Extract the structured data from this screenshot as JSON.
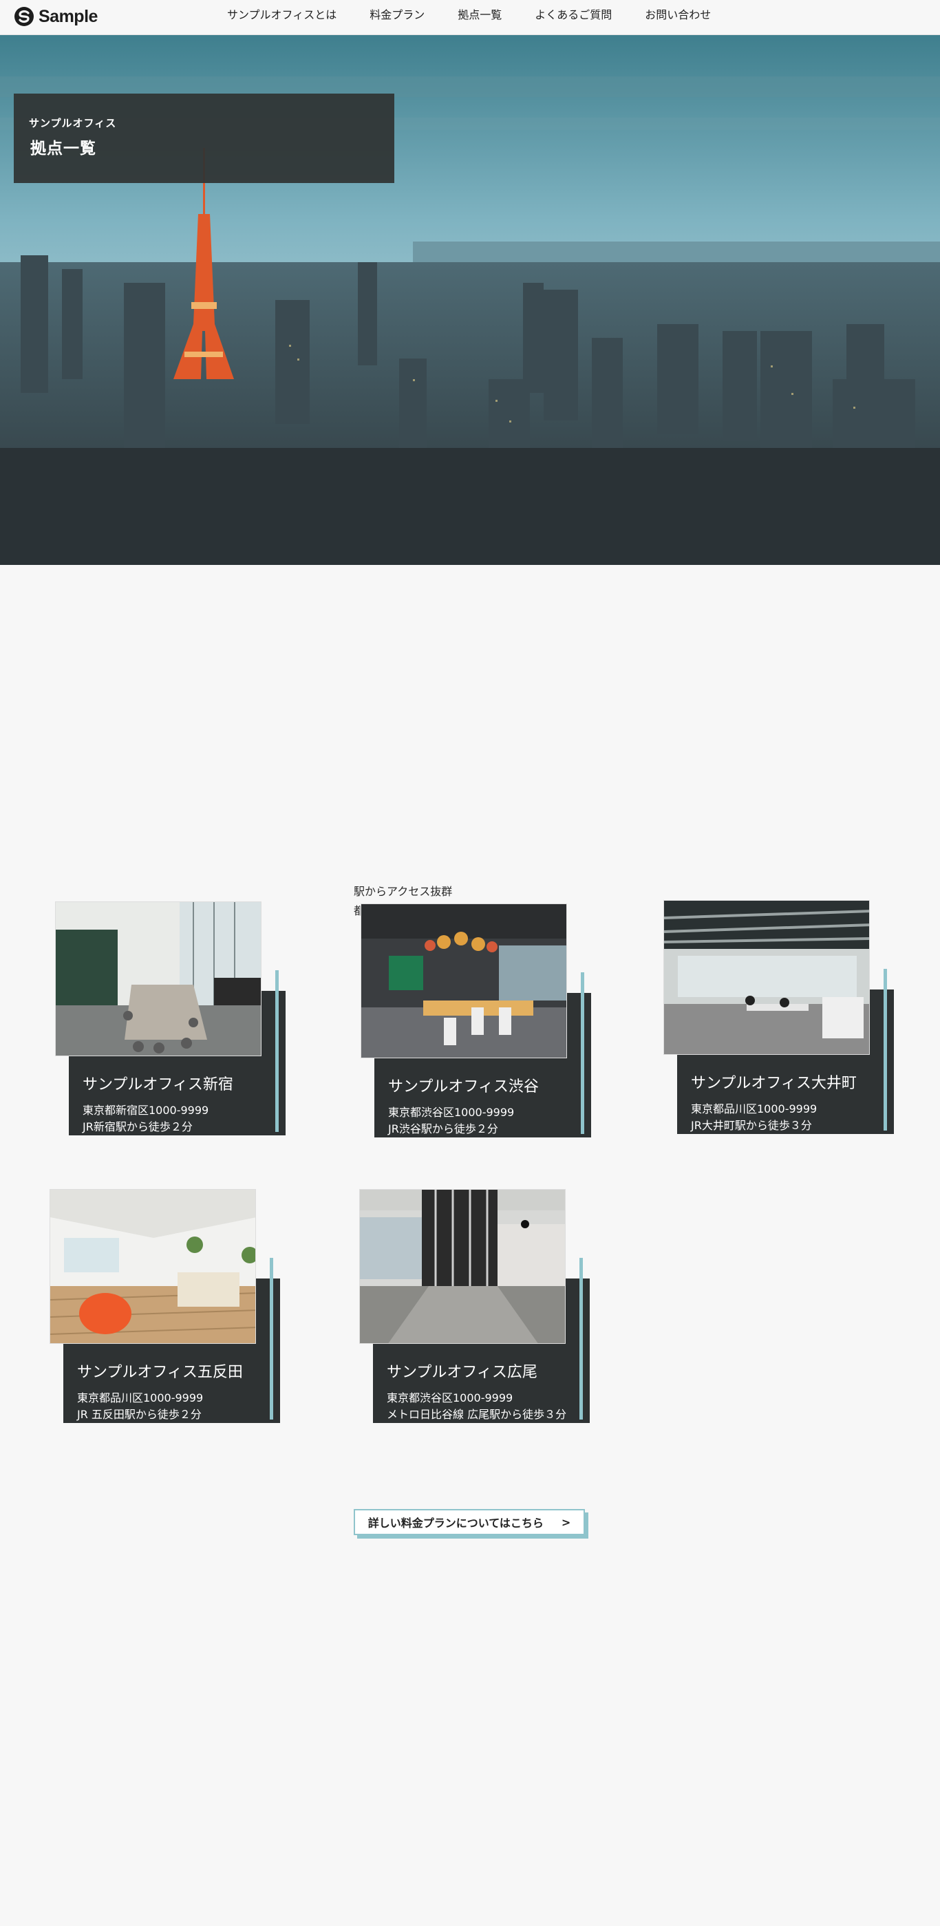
{
  "header": {
    "logo_text": "Sample",
    "logo_icon": "s-mark-logo",
    "nav": [
      {
        "label": "サンプルオフィスとは"
      },
      {
        "label": "料金プラン"
      },
      {
        "label": "拠点一覧"
      },
      {
        "label": "よくあるご質問"
      },
      {
        "label": "お問い合わせ"
      }
    ]
  },
  "hero": {
    "subtitle": "サンプルオフィス",
    "title": "拠点一覧"
  },
  "intro": {
    "line1": "駅からアクセス抜群",
    "line2": "都"
  },
  "offices": [
    {
      "name": "サンプルオフィス新宿",
      "address": "東京都新宿区1000-9999",
      "access": "JR新宿駅から徒歩２分"
    },
    {
      "name": "サンプルオフィス渋谷",
      "address": "東京都渋谷区1000-9999",
      "access": "JR渋谷駅から徒歩２分"
    },
    {
      "name": "サンプルオフィス大井町",
      "address": "東京都品川区1000-9999",
      "access": "JR大井町駅から徒歩３分"
    },
    {
      "name": "サンプルオフィス五反田",
      "address": "東京都品川区1000-9999",
      "access": "JR 五反田駅から徒歩２分"
    },
    {
      "name": "サンプルオフィス広尾",
      "address": "東京都渋谷区1000-9999",
      "access": "メトロ日比谷線 広尾駅から徒歩３分"
    }
  ],
  "cta": {
    "label": "詳しい料金プランについてはこちら",
    "arrow": ">"
  },
  "colors": {
    "background": "#f7f7f7",
    "card_dark": "#2e3233",
    "accent": "#8fc4cc"
  }
}
